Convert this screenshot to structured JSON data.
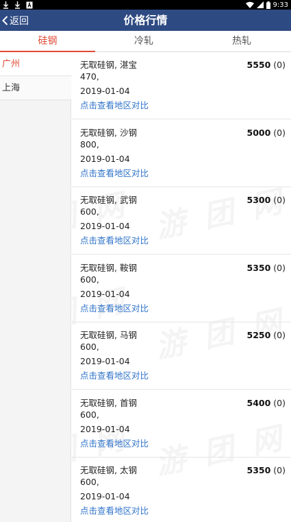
{
  "status_bar": {
    "time": "9:33",
    "left_icons": [
      "download-icon",
      "download-icon",
      "notification-a-icon"
    ],
    "right_icons": [
      "wifi-icon",
      "signal-icon",
      "battery-icon"
    ]
  },
  "header": {
    "back_label": "返回",
    "title": "价格行情",
    "bg_color": "#2e4a82"
  },
  "tabs": [
    {
      "label": "硅钢",
      "active": true
    },
    {
      "label": "冷轧",
      "active": false
    },
    {
      "label": "热轧",
      "active": false
    }
  ],
  "accent_color": "#e24a35",
  "link_color": "#2f73c9",
  "sidebar": {
    "items": [
      {
        "label": "广州",
        "active": true
      },
      {
        "label": "上海",
        "active": false
      }
    ]
  },
  "items": [
    {
      "name": "无取硅钢, 湛宝",
      "spec": "470,",
      "date": "2019-01-04",
      "price": "5550",
      "change": "(0)",
      "link": "点击查看地区对比"
    },
    {
      "name": "无取硅钢, 沙钢",
      "spec": "800,",
      "date": "2019-01-04",
      "price": "5000",
      "change": "(0)",
      "link": "点击查看地区对比"
    },
    {
      "name": "无取硅钢, 武钢",
      "spec": "600,",
      "date": "2019-01-04",
      "price": "5300",
      "change": "(0)",
      "link": "点击查看地区对比"
    },
    {
      "name": "无取硅钢, 鞍钢",
      "spec": "600,",
      "date": "2019-01-04",
      "price": "5350",
      "change": "(0)",
      "link": "点击查看地区对比"
    },
    {
      "name": "无取硅钢, 马钢",
      "spec": "600,",
      "date": "2019-01-04",
      "price": "5250",
      "change": "(0)",
      "link": "点击查看地区对比"
    },
    {
      "name": "无取硅钢, 首钢",
      "spec": "600,",
      "date": "2019-01-04",
      "price": "5400",
      "change": "(0)",
      "link": "点击查看地区对比"
    },
    {
      "name": "无取硅钢, 太钢",
      "spec": "600,",
      "date": "2019-01-04",
      "price": "5350",
      "change": "(0)",
      "link": "点击查看地区对比"
    }
  ]
}
